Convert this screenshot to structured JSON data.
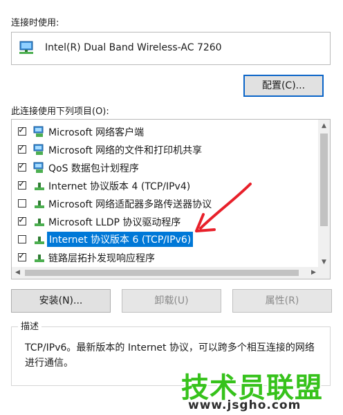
{
  "connect_using_label": "连接时使用:",
  "adapter_name": "Intel(R) Dual Band Wireless-AC 7260",
  "configure_button": "配置(C)...",
  "items_label": "此连接使用下列项目(O):",
  "items": [
    {
      "label": "Microsoft 网络客户端",
      "checked": true,
      "icon": "network-client-icon"
    },
    {
      "label": "Microsoft 网络的文件和打印机共享",
      "checked": true,
      "icon": "file-printer-sharing-icon"
    },
    {
      "label": "QoS 数据包计划程序",
      "checked": true,
      "icon": "qos-scheduler-icon"
    },
    {
      "label": "Internet 协议版本 4 (TCP/IPv4)",
      "checked": true,
      "icon": "protocol-icon"
    },
    {
      "label": "Microsoft 网络适配器多路传送器协议",
      "checked": false,
      "icon": "protocol-icon"
    },
    {
      "label": "Microsoft LLDP 协议驱动程序",
      "checked": true,
      "icon": "protocol-icon"
    },
    {
      "label": "Internet 协议版本 6 (TCP/IPv6)",
      "checked": false,
      "icon": "protocol-icon",
      "selected": true
    },
    {
      "label": "链路层拓扑发现响应程序",
      "checked": true,
      "icon": "protocol-icon"
    }
  ],
  "install_button": "安装(N)...",
  "uninstall_button": "卸载(U)",
  "properties_button": "属性(R)",
  "description_title": "描述",
  "description_text": "TCP/IPv6。最新版本的 Internet 协议，可以跨多个相互连接的网络进行通信。",
  "watermark_title": "技术员联盟",
  "watermark_url": "www.jsgho.com",
  "colors": {
    "selection": "#0078d7",
    "annotation_arrow": "#e8202a",
    "watermark": "#36c21b"
  }
}
